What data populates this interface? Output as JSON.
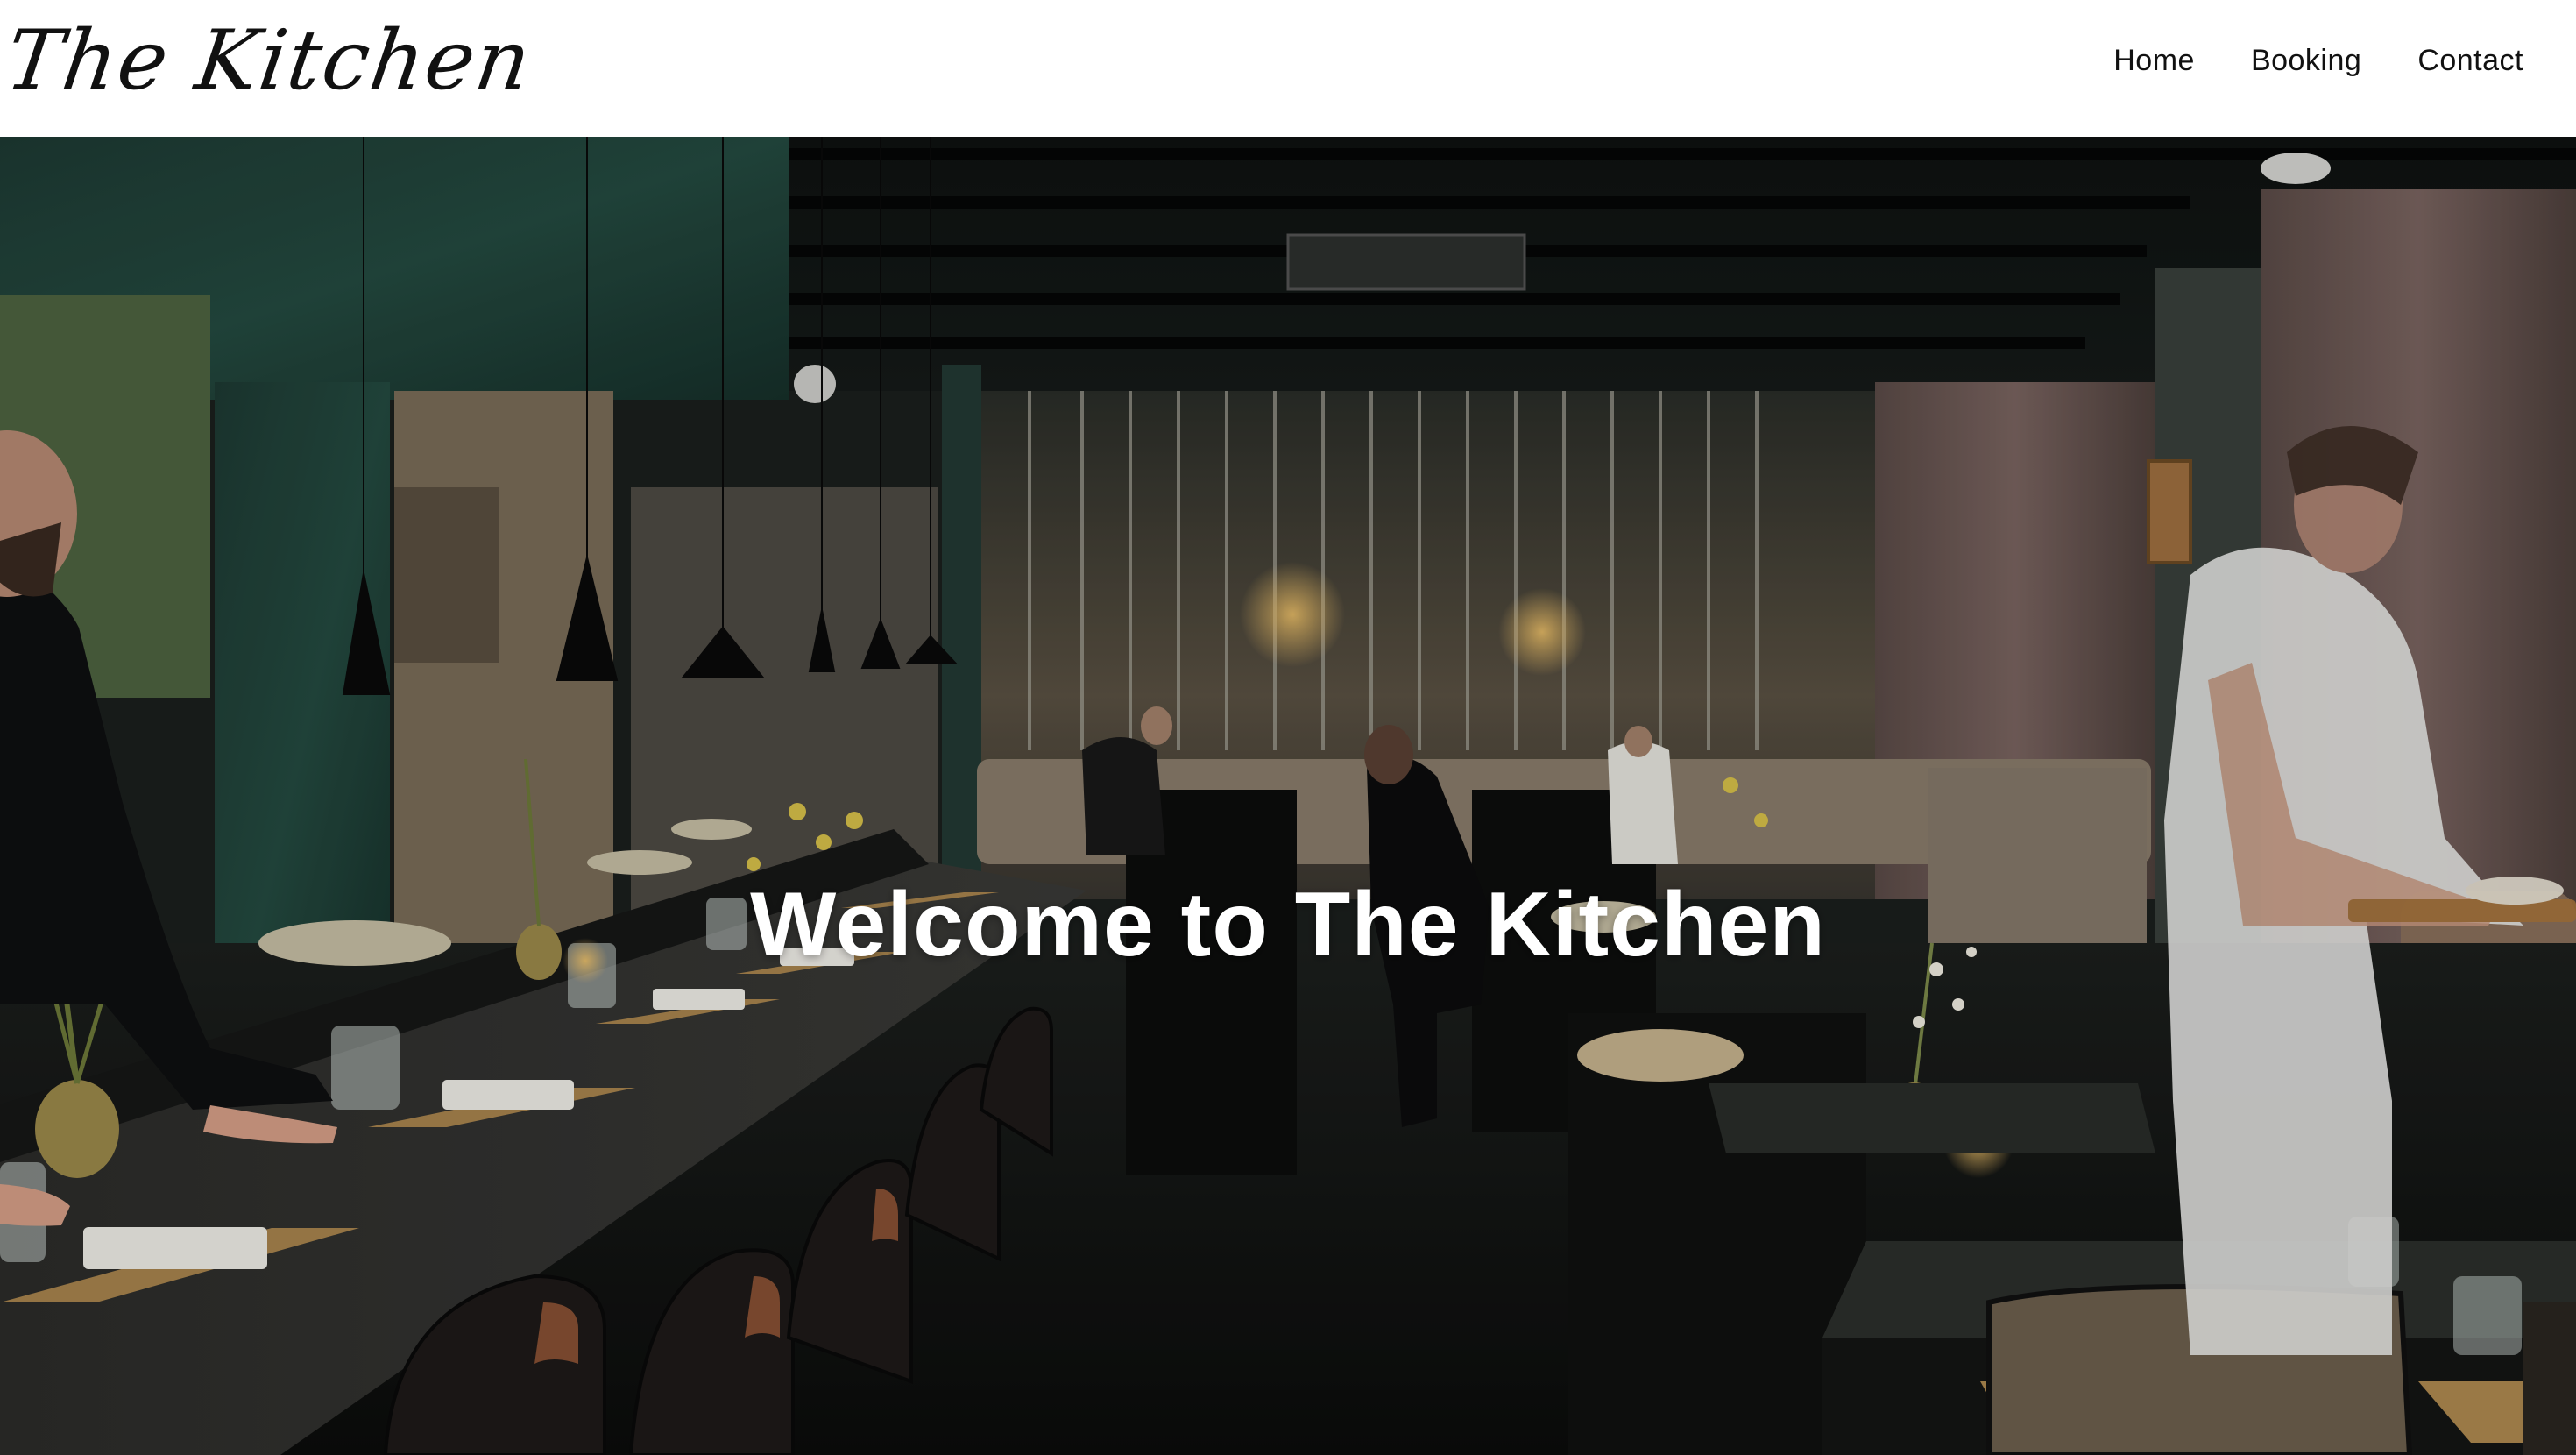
{
  "site": {
    "logo_text": "The Kitchen"
  },
  "nav": {
    "items": [
      {
        "label": "Home"
      },
      {
        "label": "Booking"
      },
      {
        "label": "Contact"
      }
    ]
  },
  "hero": {
    "title": "Welcome to The Kitchen",
    "image_icon": "restaurant-interior-photo"
  },
  "colors": {
    "header_bg": "#ffffff",
    "text_dark": "#111111",
    "hero_text": "#ffffff"
  }
}
